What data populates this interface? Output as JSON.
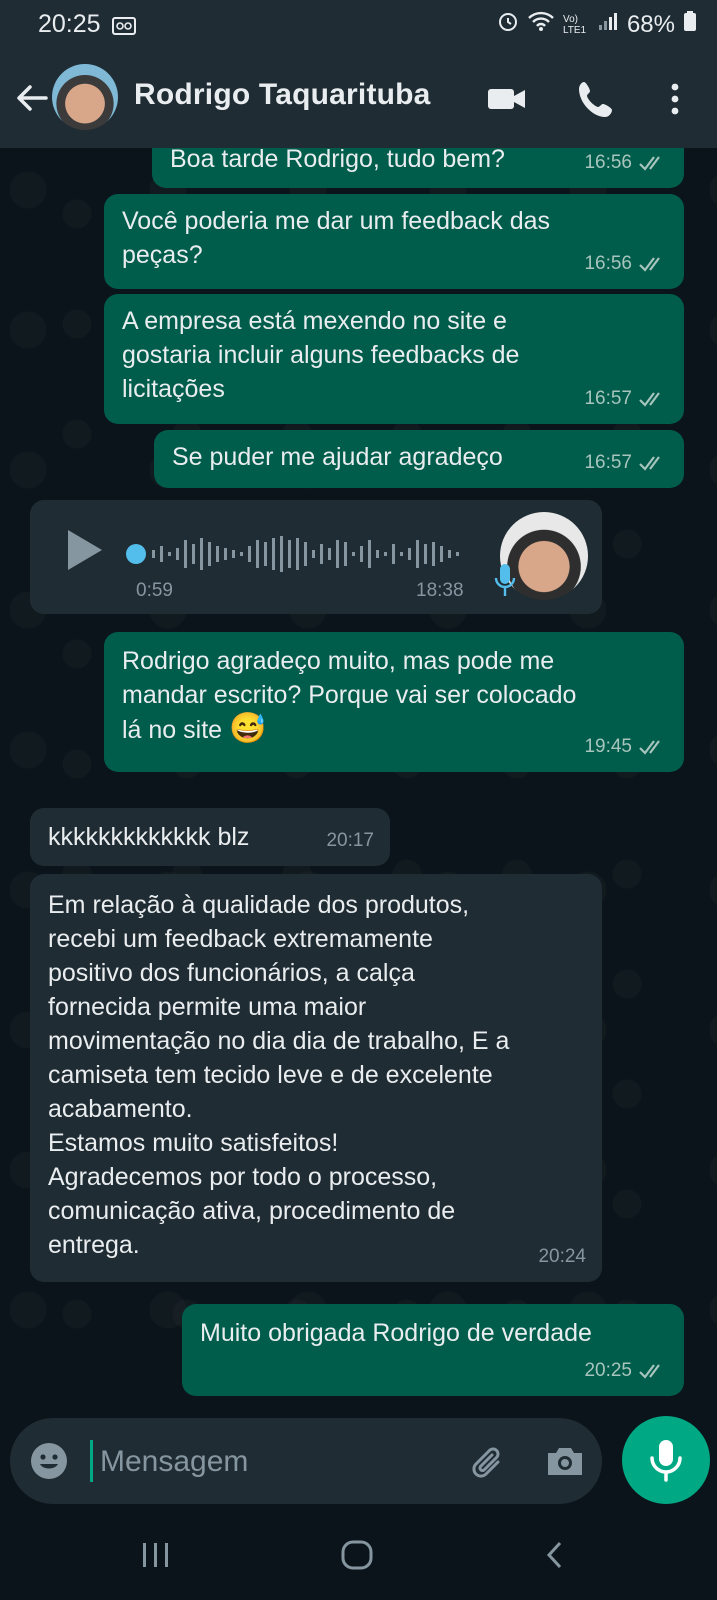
{
  "status_bar": {
    "time": "20:25",
    "battery": "68%",
    "network": "Vo) LTE1"
  },
  "header": {
    "contact_name": "Rodrigo Taquarituba"
  },
  "messages": [
    {
      "text": "Boa tarde Rodrigo, tudo bem?",
      "time": "16:56"
    },
    {
      "text": "Você poderia me dar um feedback das\npeças?",
      "time": "16:56"
    },
    {
      "text": "A empresa está mexendo no site e\ngostaria incluir alguns feedbacks de\nlicitações",
      "time": "16:57"
    },
    {
      "text": "Se puder me ajudar agradeço",
      "time": "16:57"
    },
    {
      "text": "Rodrigo agradeço muito, mas pode me\nmandar escrito? Porque vai ser colocado\nlá no site",
      "emoji": "😅",
      "time": "19:45"
    },
    {
      "text": "kkkkkkkkkkkkk blz",
      "time": "20:17"
    },
    {
      "text": "Em relação à qualidade dos produtos,\nrecebi um feedback extremamente\npositivo dos funcionários, a calça\nfornecida permite uma maior\nmovimentação no dia dia de trabalho, E a\ncamiseta tem tecido leve e de excelente\nacabamento.\nEstamos muito satisfeitos!\nAgradecemos por todo o processo,\ncomunicação ativa, procedimento de\nentrega.",
      "time": "20:24"
    },
    {
      "text": "Muito obrigada Rodrigo de verdade",
      "time": "20:25"
    }
  ],
  "voice_message": {
    "duration": "0:59",
    "time": "18:38"
  },
  "composer": {
    "placeholder": "Mensagem"
  },
  "colors": {
    "outgoing": "#005c4b",
    "incoming": "#202c33",
    "accent": "#00a884",
    "ticks": "#a7c5bd"
  }
}
